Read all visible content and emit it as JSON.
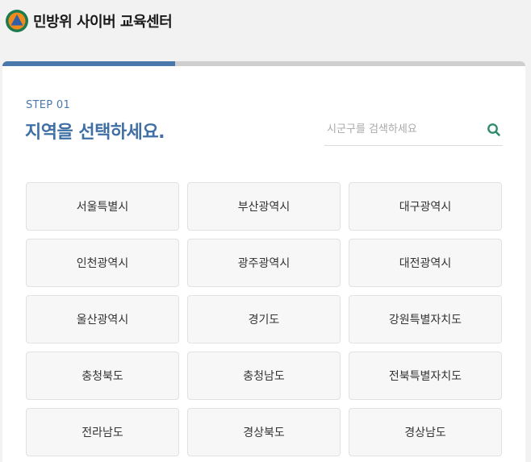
{
  "header": {
    "brand": "민방위 사이버 교육센터",
    "logo_icon": "civil-defense-emblem-icon"
  },
  "progress": {
    "value": 0.33
  },
  "step": {
    "label": "STEP 01",
    "title": "지역을 선택하세요."
  },
  "search": {
    "placeholder": "시군구를 검색하세요",
    "value": "",
    "icon": "search-icon"
  },
  "regions": [
    "서울특별시",
    "부산광역시",
    "대구광역시",
    "인천광역시",
    "광주광역시",
    "대전광역시",
    "울산광역시",
    "경기도",
    "강원특별자치도",
    "충청북도",
    "충청남도",
    "전북특별자치도",
    "전라남도",
    "경상북도",
    "경상남도"
  ],
  "colors": {
    "accent": "#4a78ad",
    "title": "#3f6fa5",
    "search_icon": "#2e8b6e",
    "logo_green": "#1b7a4e",
    "logo_orange": "#f08a1c",
    "logo_blue": "#2f5fa8"
  }
}
